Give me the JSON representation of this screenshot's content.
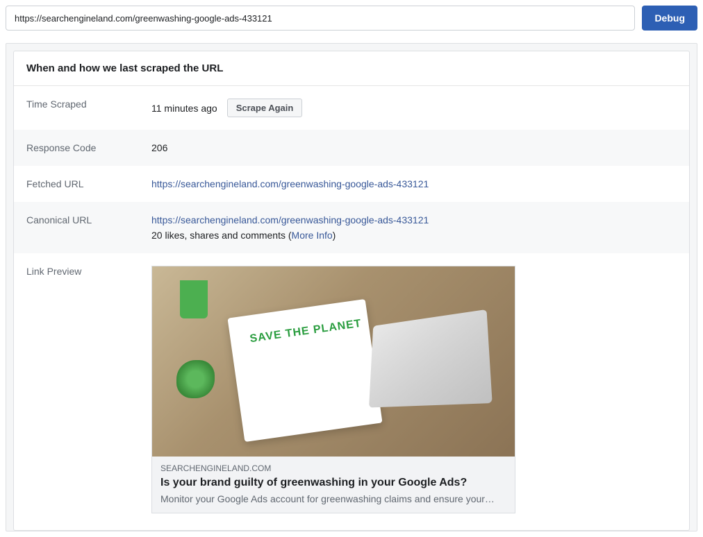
{
  "topbar": {
    "url_value": "https://searchengineland.com/greenwashing-google-ads-433121",
    "debug_label": "Debug"
  },
  "card": {
    "header": "When and how we last scraped the URL"
  },
  "rows": {
    "time_scraped": {
      "label": "Time Scraped",
      "value": "11 minutes ago",
      "button": "Scrape Again"
    },
    "response_code": {
      "label": "Response Code",
      "value": "206"
    },
    "fetched_url": {
      "label": "Fetched URL",
      "value": "https://searchengineland.com/greenwashing-google-ads-433121"
    },
    "canonical_url": {
      "label": "Canonical URL",
      "value": "https://searchengineland.com/greenwashing-google-ads-433121",
      "meta_prefix": "20 likes, shares and comments (",
      "more_info": "More Info",
      "meta_suffix": ")"
    },
    "link_preview": {
      "label": "Link Preview"
    }
  },
  "preview": {
    "image_text": "SAVE THE PLANET",
    "domain": "SEARCHENGINELAND.COM",
    "title": "Is your brand guilty of greenwashing in your Google Ads?",
    "description": "Monitor your Google Ads account for greenwashing claims and ensure your…"
  }
}
